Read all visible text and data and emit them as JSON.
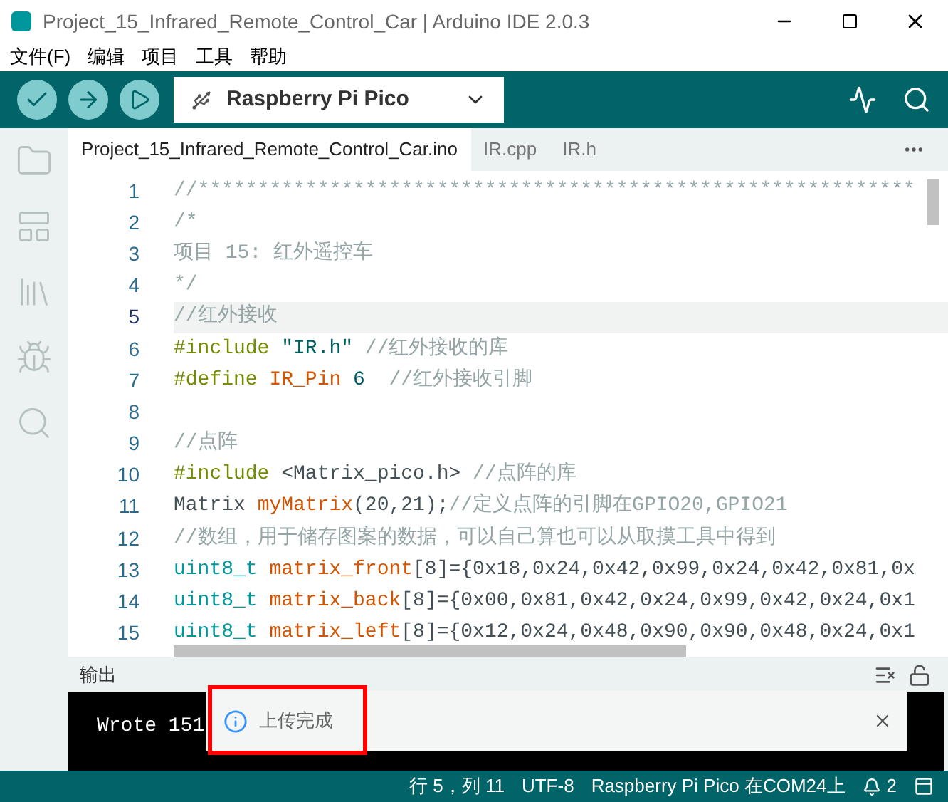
{
  "window": {
    "title": "Project_15_Infrared_Remote_Control_Car | Arduino IDE 2.0.3"
  },
  "menu": [
    "文件(F)",
    "编辑",
    "项目",
    "工具",
    "帮助"
  ],
  "board": {
    "name": "Raspberry Pi Pico"
  },
  "tabs": [
    {
      "label": "Project_15_Infrared_Remote_Control_Car.ino",
      "selected": true
    },
    {
      "label": "IR.cpp",
      "selected": false
    },
    {
      "label": "IR.h",
      "selected": false
    }
  ],
  "sidebar": [
    {
      "kind": "folder",
      "selected": false
    },
    {
      "kind": "board",
      "selected": false
    },
    {
      "kind": "library",
      "selected": false
    },
    {
      "kind": "debug",
      "selected": false
    },
    {
      "kind": "search",
      "selected": false
    }
  ],
  "code_lines": [
    {
      "number": "1",
      "current": false,
      "tokens": [
        {
          "kind": "comment",
          "text": "//************************************************************"
        }
      ]
    },
    {
      "number": "2",
      "current": false,
      "tokens": [
        {
          "kind": "comment",
          "text": "/*"
        }
      ]
    },
    {
      "number": "3",
      "current": false,
      "tokens": [
        {
          "kind": "comment",
          "text": "项目 15: 红外遥控车"
        }
      ]
    },
    {
      "number": "4",
      "current": false,
      "tokens": [
        {
          "kind": "comment",
          "text": "*/"
        }
      ]
    },
    {
      "number": "5",
      "current": true,
      "tokens": [
        {
          "kind": "comment",
          "text": "//红外接收"
        }
      ]
    },
    {
      "number": "6",
      "current": false,
      "tokens": [
        {
          "kind": "keyword",
          "text": "#include"
        },
        {
          "kind": "string",
          "text": " \"IR.h\""
        },
        {
          "kind": "comment",
          "text": " //红外接收的库"
        }
      ]
    },
    {
      "number": "7",
      "current": false,
      "tokens": [
        {
          "kind": "keyword",
          "text": "#define"
        },
        {
          "kind": "name",
          "text": " IR_Pin"
        },
        {
          "kind": "number",
          "text": " 6"
        },
        {
          "kind": "comment",
          "text": "  //红外接收引脚"
        }
      ]
    },
    {
      "number": "8",
      "current": false
    },
    {
      "number": "9",
      "current": false,
      "tokens": [
        {
          "kind": "comment",
          "text": "//点阵"
        }
      ]
    },
    {
      "number": "10",
      "current": false,
      "tokens": [
        {
          "kind": "keyword",
          "text": "#include"
        },
        {
          "kind": "plain",
          "text": " <Matrix_pico.h>"
        },
        {
          "kind": "comment",
          "text": " //点阵的库"
        }
      ]
    },
    {
      "number": "11",
      "current": false,
      "tokens": [
        {
          "kind": "plain",
          "text": "Matrix "
        },
        {
          "kind": "name",
          "text": "myMatrix"
        },
        {
          "kind": "plain",
          "text": "(20,21);"
        },
        {
          "kind": "comment",
          "text": "//定义点阵的引脚在GPIO20,GPIO21"
        }
      ]
    },
    {
      "number": "12",
      "current": false,
      "tokens": [
        {
          "kind": "comment",
          "text": "//数组，用于储存图案的数据，可以自己算也可以从取摸工具中得到"
        }
      ]
    },
    {
      "number": "13",
      "current": false,
      "tokens": [
        {
          "kind": "type",
          "text": "uint8_t"
        },
        {
          "kind": "name",
          "text": " matrix_front"
        },
        {
          "kind": "plain",
          "text": "[8]={0x18,0x24,0x42,0x99,0x24,0x42,0x81,0x"
        }
      ]
    },
    {
      "number": "14",
      "current": false,
      "tokens": [
        {
          "kind": "type",
          "text": "uint8_t"
        },
        {
          "kind": "name",
          "text": " matrix_back"
        },
        {
          "kind": "plain",
          "text": "[8]={0x00,0x81,0x42,0x24,0x99,0x42,0x24,0x1"
        }
      ]
    },
    {
      "number": "15",
      "current": false,
      "tokens": [
        {
          "kind": "type",
          "text": "uint8_t"
        },
        {
          "kind": "name",
          "text": " matrix_left"
        },
        {
          "kind": "plain",
          "text": "[8]={0x12,0x24,0x48,0x90,0x90,0x48,0x24,0x1"
        }
      ]
    }
  ],
  "output": {
    "title": "输出",
    "lines": [
      "Wrote 151"
    ]
  },
  "notification": {
    "message": "上传完成",
    "highlighted": true
  },
  "status_bar": {
    "position": "行 5，列 11",
    "encoding": "UTF-8",
    "connection": "Raspberry Pi Pico 在COM24上",
    "notifications": "2"
  }
}
